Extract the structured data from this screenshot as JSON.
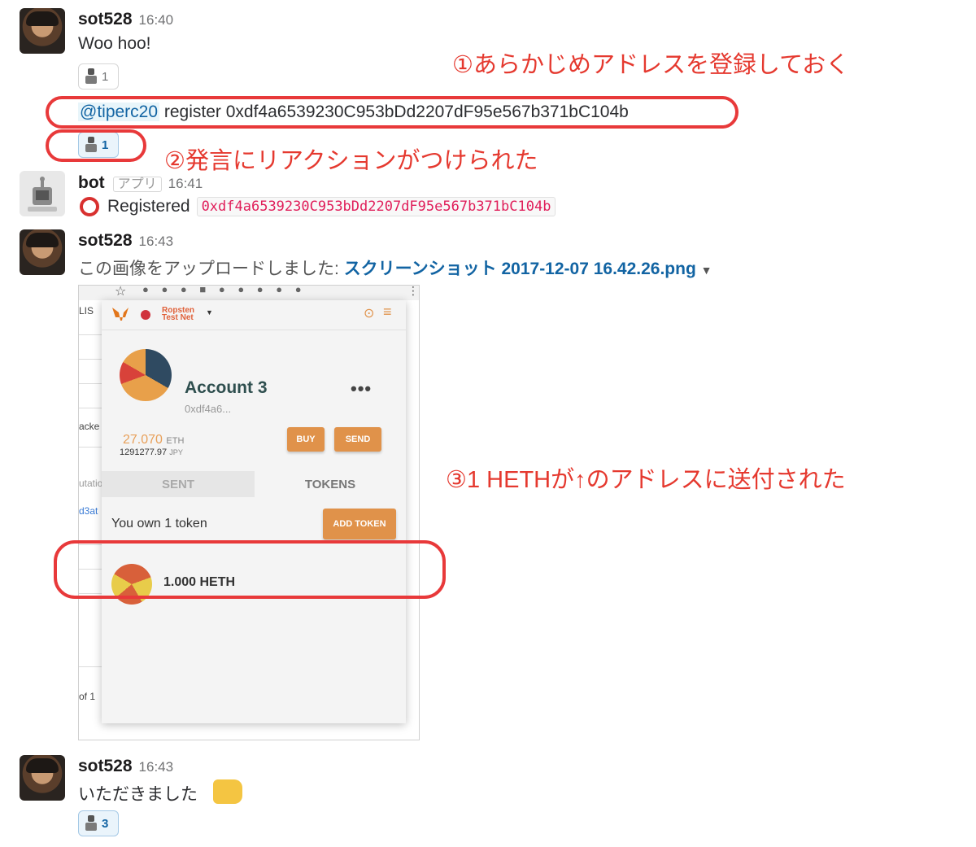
{
  "messages": [
    {
      "user": "sot528",
      "time": "16:40",
      "text": "Woo hoo!",
      "reaction_count": "1"
    },
    {
      "mention": "@tiperc20",
      "text": "register 0xdf4a6539230C953bDd2207dF95e567b371bC104b",
      "reaction_count": "1"
    },
    {
      "user": "bot",
      "app_label": "アプリ",
      "time": "16:41",
      "text": "Registered",
      "code": "0xdf4a6539230C953bDd2207dF95e567b371bC104b"
    },
    {
      "user": "sot528",
      "time": "16:43",
      "text": "この画像をアップロードしました:",
      "file_link": "スクリーンショット 2017-12-07 16.42.26.png"
    },
    {
      "user": "sot528",
      "time": "16:43",
      "text": "いただきました",
      "reaction_count": "3"
    }
  ],
  "annotations": {
    "a1": "①あらかじめアドレスを登録しておく",
    "a2": "②発言にリアクションがつけられた",
    "a3": "③1 HETHが↑のアドレスに送付された"
  },
  "screenshot": {
    "network": "Ropsten",
    "network2": "Test Net",
    "account_name": "Account 3",
    "account_addr": "0xdf4a6...",
    "eth_balance": "27.070",
    "eth_unit": "ETH",
    "fiat_balance": "1291277.97",
    "fiat_unit": "JPY",
    "buy_label": "BUY",
    "send_label": "SEND",
    "tab_sent": "SENT",
    "tab_tokens": "TOKENS",
    "own_text": "You own 1 token",
    "add_token_label": "ADD TOKEN",
    "token_amount": "1.000 HETH",
    "bg_texts": [
      "LIS",
      "acke",
      "utatio",
      "d3at",
      "of 1"
    ]
  },
  "colors": {
    "annotation_red": "#e5392f",
    "link_blue": "#1264a3",
    "code_red": "#e01e5a",
    "metamask_orange": "#e0924a"
  }
}
